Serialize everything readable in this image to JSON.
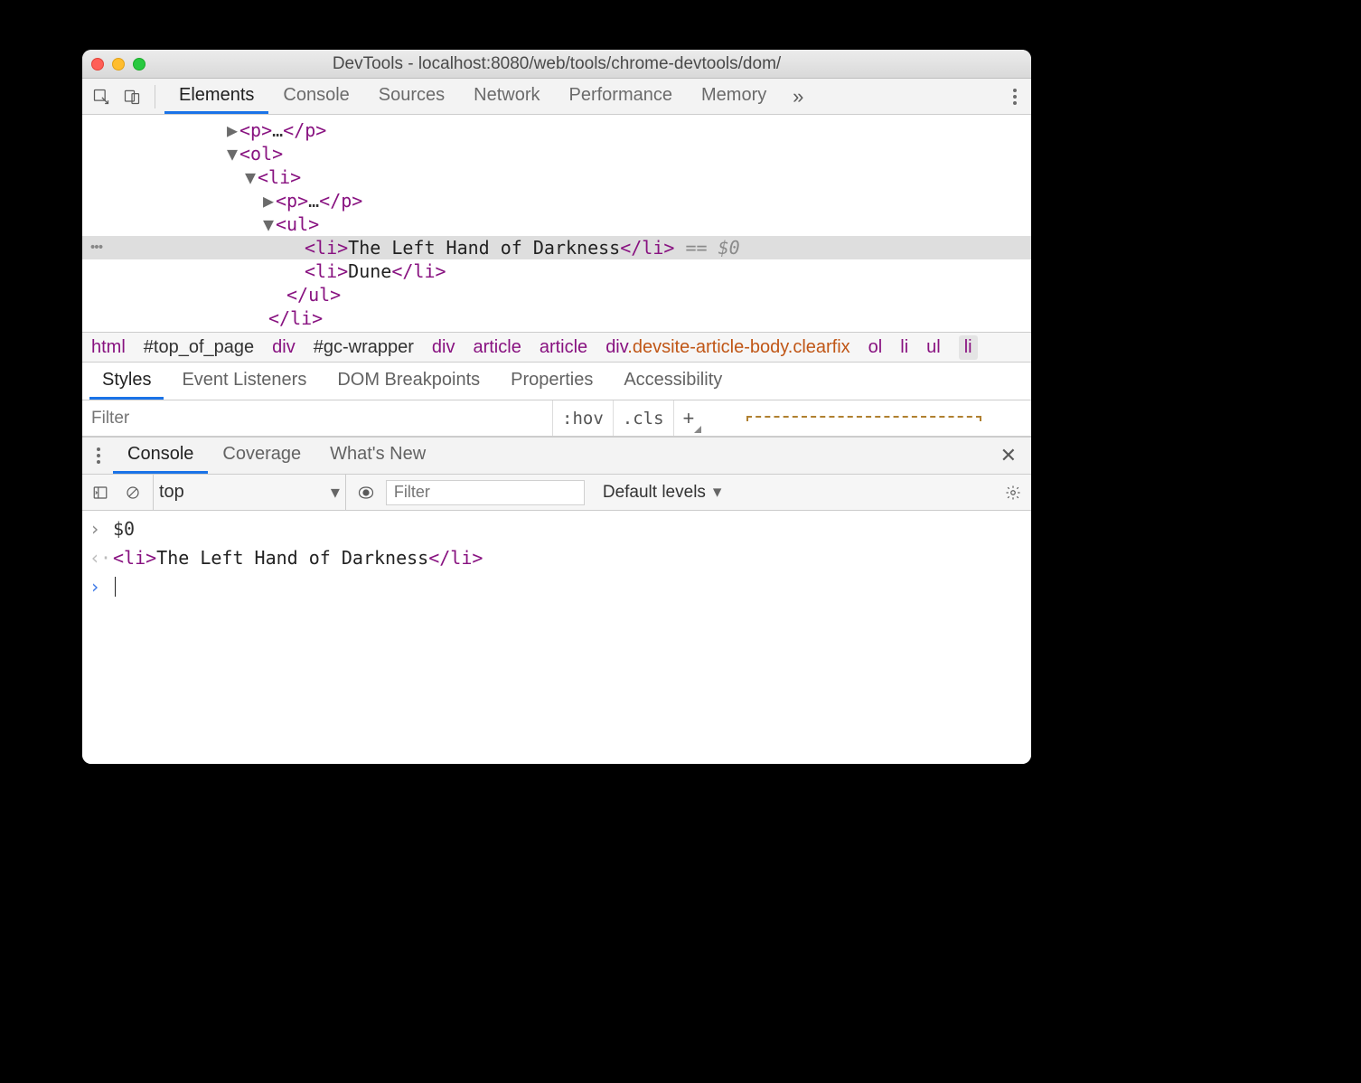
{
  "window": {
    "title": "DevTools - localhost:8080/web/tools/chrome-devtools/dom/"
  },
  "mainTabs": [
    "Elements",
    "Console",
    "Sources",
    "Network",
    "Performance",
    "Memory"
  ],
  "activeMainTab": "Elements",
  "domTree": {
    "rows": [
      {
        "indent": 160,
        "arrow": "▶",
        "html": "<p>…</p>"
      },
      {
        "indent": 160,
        "arrow": "▼",
        "html": "<ol>"
      },
      {
        "indent": 180,
        "arrow": "▼",
        "html": "<li>"
      },
      {
        "indent": 200,
        "arrow": "▶",
        "html": "<p>…</p>"
      },
      {
        "indent": 200,
        "arrow": "▼",
        "html": "<ul>"
      },
      {
        "indent": 232,
        "arrow": "",
        "html": "<li>The Left Hand of Darkness</li>",
        "selected": true,
        "suffix": " == $0"
      },
      {
        "indent": 232,
        "arrow": "",
        "html": "<li>Dune</li>"
      },
      {
        "indent": 212,
        "arrow": "",
        "html": "</ul>"
      },
      {
        "indent": 192,
        "arrow": "",
        "html": "</li>"
      }
    ]
  },
  "breadcrumbs": [
    {
      "t": "html",
      "k": "tag"
    },
    {
      "t": "#top_of_page",
      "k": "id"
    },
    {
      "t": "div",
      "k": "tag"
    },
    {
      "t": "#gc-wrapper",
      "k": "id"
    },
    {
      "t": "div",
      "k": "tag"
    },
    {
      "t": "article",
      "k": "tag"
    },
    {
      "t": "article",
      "k": "tag"
    },
    {
      "t": "div.devsite-article-body.clearfix",
      "k": "cls"
    },
    {
      "t": "ol",
      "k": "tag"
    },
    {
      "t": "li",
      "k": "tag"
    },
    {
      "t": "ul",
      "k": "tag"
    },
    {
      "t": "li",
      "k": "last"
    }
  ],
  "stylesTabs": [
    "Styles",
    "Event Listeners",
    "DOM Breakpoints",
    "Properties",
    "Accessibility"
  ],
  "activeStylesTab": "Styles",
  "filter": {
    "placeholder": "Filter",
    "hov": ":hov",
    "cls": ".cls",
    "plus": "+"
  },
  "drawerTabs": [
    "Console",
    "Coverage",
    "What's New"
  ],
  "activeDrawerTab": "Console",
  "consoleToolbar": {
    "context": "top",
    "filterPlaceholder": "Filter",
    "levels": "Default levels"
  },
  "console": {
    "input": "$0",
    "outputHtml": "<li>The Left Hand of Darkness</li>"
  }
}
